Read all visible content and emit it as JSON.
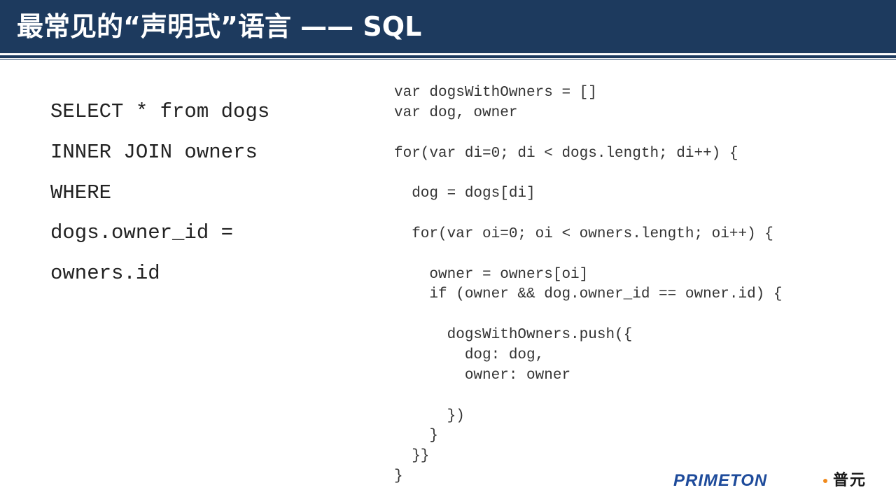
{
  "slide": {
    "title": "最常见的“声明式”语言 —— SQL"
  },
  "sql_query": {
    "lines": [
      "SELECT * from dogs",
      "INNER JOIN owners",
      "WHERE",
      "dogs.owner_id =",
      "owners.id"
    ]
  },
  "imperative_code": {
    "lines": [
      "var dogsWithOwners = []",
      "var dog, owner",
      "",
      "for(var di=0; di < dogs.length; di++) {",
      "",
      "  dog = dogs[di]",
      "",
      "  for(var oi=0; oi < owners.length; oi++) {",
      "",
      "    owner = owners[oi]",
      "    if (owner && dog.owner_id == owner.id) {",
      "",
      "      dogsWithOwners.push({",
      "        dog: dog,",
      "        owner: owner",
      "",
      "      })",
      "    }",
      "  }}",
      "}"
    ]
  },
  "logo": {
    "wordmark": "PRIMETON",
    "chinese_name": "普元"
  }
}
